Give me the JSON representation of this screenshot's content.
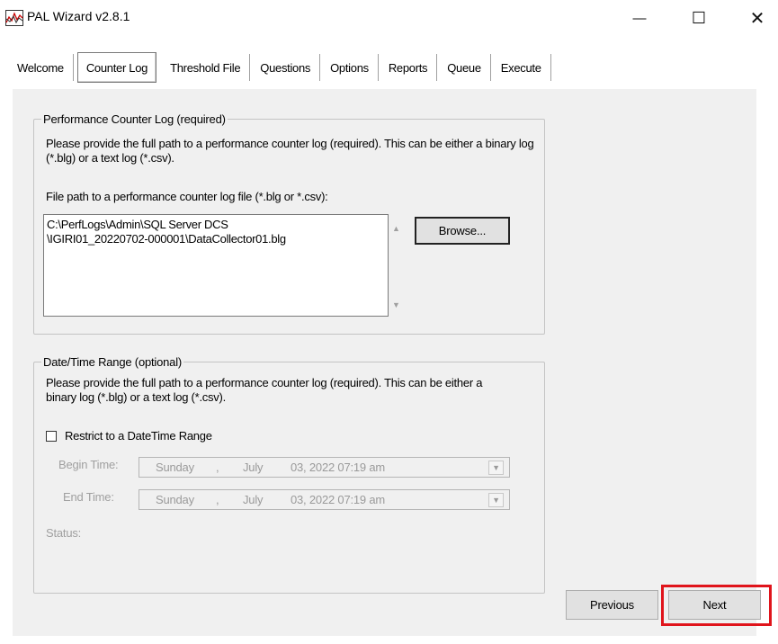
{
  "window": {
    "title": "PAL Wizard v2.8.1",
    "minimize": "—",
    "maximize": "☐",
    "close": "✕"
  },
  "tabs": [
    {
      "label": "Welcome"
    },
    {
      "label": "Counter Log"
    },
    {
      "label": "Threshold File"
    },
    {
      "label": "Questions"
    },
    {
      "label": "Options"
    },
    {
      "label": "Reports"
    },
    {
      "label": "Queue"
    },
    {
      "label": "Execute"
    }
  ],
  "active_tab": "Counter Log",
  "counter_log": {
    "group_title": "Performance Counter Log (required)",
    "description": "Please provide the full path to a performance counter log (required). This can be either a binary log (*.blg) or a text log (*.csv).",
    "file_path_label": "File path to a performance counter log file (*.blg or *.csv):",
    "file_path_value": "C:\\PerfLogs\\Admin\\SQL Server DCS\n\\IGIRI01_20220702-000001\\DataCollector01.blg",
    "browse_label": "Browse..."
  },
  "date_range": {
    "group_title": "Date/Time Range (optional)",
    "description": "Please provide the full path to a performance counter log (required). This can be either a binary log (*.blg) or a text log (*.csv).",
    "restrict_label": "Restrict to a DateTime Range",
    "restrict_checked": false,
    "begin_label": "Begin Time:",
    "begin_day": "Sunday",
    "begin_month": "July",
    "begin_rest": "03, 2022 07:19 am",
    "end_label": "End Time:",
    "end_day": "Sunday",
    "end_month": "July",
    "end_rest": "03, 2022 07:19 am",
    "status_label": "Status:"
  },
  "nav": {
    "previous_label": "Previous",
    "next_label": "Next"
  },
  "colors": {
    "highlight": "#e0141b",
    "panel_bg": "#f0f0f0"
  },
  "icons": {
    "app": "pal-chart-icon",
    "scroll_up": "scroll-up-icon",
    "scroll_down": "scroll-down-icon",
    "dropdown": "chevron-down-icon"
  }
}
